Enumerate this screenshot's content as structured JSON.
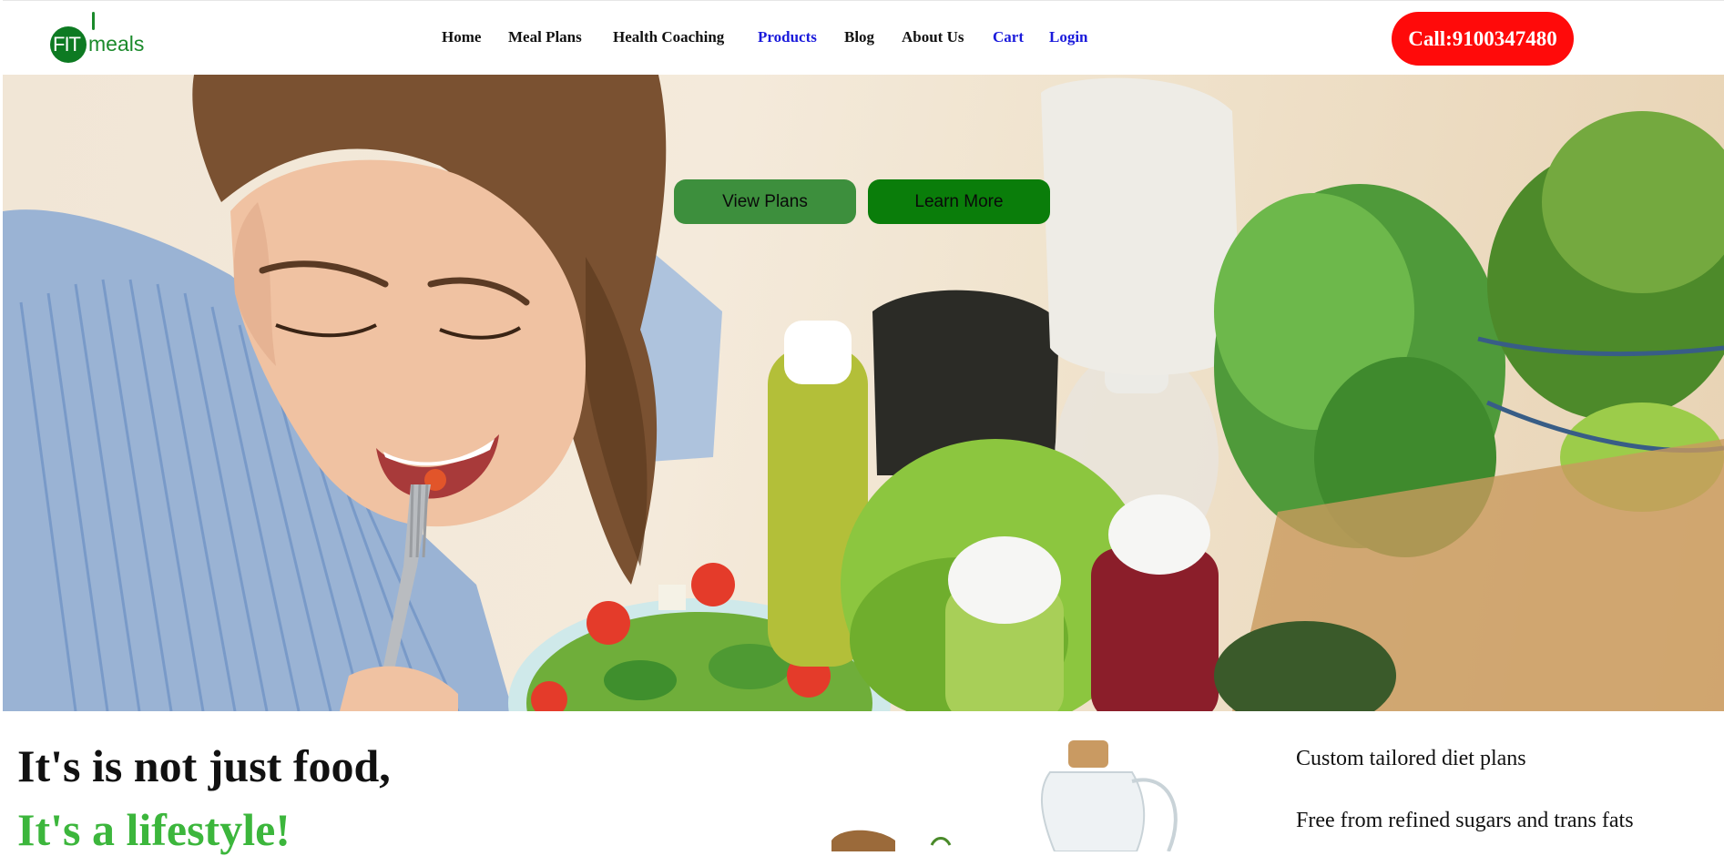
{
  "header": {
    "logo_fit": "FIT",
    "logo_meals": "meals",
    "nav": [
      {
        "label": "Home"
      },
      {
        "label": "Meal Plans"
      },
      {
        "label": "Health Coaching"
      },
      {
        "label": "Products"
      },
      {
        "label": "Blog"
      },
      {
        "label": "About Us"
      },
      {
        "label": "Cart"
      },
      {
        "label": "Login"
      }
    ],
    "call_label": "Call:9100347480"
  },
  "hero": {
    "view_plans_label": "View Plans",
    "learn_more_label": "Learn More"
  },
  "intro": {
    "headline_line1": "It's is not just food,",
    "headline_line2": "It's a lifestyle!",
    "features": [
      "Custom tailored diet plans",
      "Free from refined sugars and trans fats"
    ]
  },
  "colors": {
    "brand_green": "#1b8a2b",
    "accent_green": "#3cb63c",
    "call_red": "#ff0a0a",
    "link_blue": "#1a1adb"
  }
}
